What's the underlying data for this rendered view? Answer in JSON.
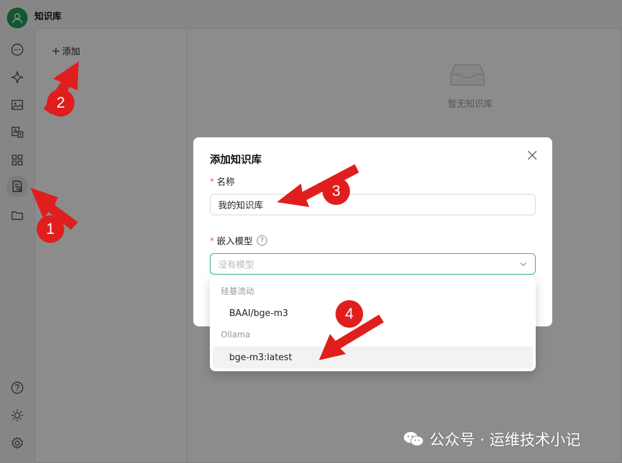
{
  "app": {
    "title": "知识库"
  },
  "sidebar": {
    "items": [
      {
        "icon": "chat-icon"
      },
      {
        "icon": "sparkle-icon"
      },
      {
        "icon": "image-icon"
      },
      {
        "icon": "translate-icon"
      },
      {
        "icon": "apps-grid-icon"
      },
      {
        "icon": "knowledge-base-icon",
        "active": true
      },
      {
        "icon": "folder-icon"
      }
    ],
    "bottom": [
      {
        "icon": "help-icon"
      },
      {
        "icon": "theme-sun-icon"
      },
      {
        "icon": "settings-gear-icon"
      }
    ]
  },
  "list_panel": {
    "add_label": "添加"
  },
  "empty_state": {
    "text": "暂无知识库"
  },
  "modal": {
    "title": "添加知识库",
    "name_label": "名称",
    "name_value": "我的知识库",
    "model_label": "嵌入模型",
    "model_placeholder": "没有模型",
    "help_glyph": "?"
  },
  "dropdown": {
    "groups": [
      {
        "label": "硅基流动",
        "options": [
          "BAAI/bge-m3"
        ]
      },
      {
        "label": "Ollama",
        "options": [
          "bge-m3:latest"
        ]
      }
    ]
  },
  "annotations": {
    "badges": [
      "1",
      "2",
      "3",
      "4"
    ],
    "color": "#e01e1e"
  },
  "watermark": {
    "text": "公众号 · 运维技术小记"
  },
  "colors": {
    "brand": "#1e9f5b",
    "focus_border": "#2eb872",
    "required": "#ff4d4f"
  }
}
